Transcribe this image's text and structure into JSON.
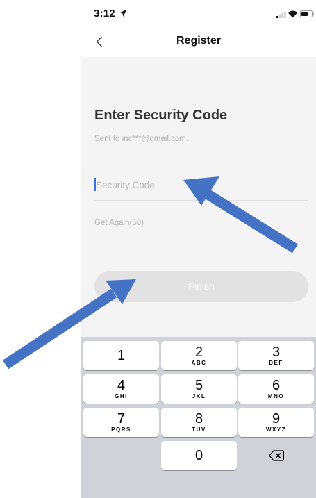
{
  "status_bar": {
    "time": "3:12",
    "icons": [
      "location-arrow-icon",
      "cellular-signal-icon",
      "wifi-icon",
      "battery-icon"
    ]
  },
  "nav": {
    "title": "Register",
    "back_icon": "chevron-left-icon"
  },
  "content": {
    "heading": "Enter Security Code",
    "sent_to": "Sent to inc***@gmail.com.",
    "code_input": {
      "placeholder": "Security Code",
      "value": ""
    },
    "get_again": "Get Again(50)",
    "finish_label": "Finish"
  },
  "keypad": {
    "keys": [
      {
        "digit": "1",
        "letters": ""
      },
      {
        "digit": "2",
        "letters": "ABC"
      },
      {
        "digit": "3",
        "letters": "DEF"
      },
      {
        "digit": "4",
        "letters": "GHI"
      },
      {
        "digit": "5",
        "letters": "JKL"
      },
      {
        "digit": "6",
        "letters": "MNO"
      },
      {
        "digit": "7",
        "letters": "PQRS"
      },
      {
        "digit": "8",
        "letters": "TUV"
      },
      {
        "digit": "9",
        "letters": "WXYZ"
      },
      {
        "digit": "0",
        "letters": ""
      }
    ],
    "delete_icon": "backspace-icon"
  },
  "annotations": {
    "arrow_color": "#4472c4",
    "arrows": [
      "arrow-to-security-code-field",
      "arrow-to-finish-button"
    ]
  },
  "colors": {
    "background": "#f4f4f4",
    "heading_text": "#333333",
    "muted_text": "#b3b3b3",
    "finish_button_disabled": "#e2e2e2",
    "cursor": "#3a6fe0",
    "keypad_background": "#cfd2d8"
  }
}
